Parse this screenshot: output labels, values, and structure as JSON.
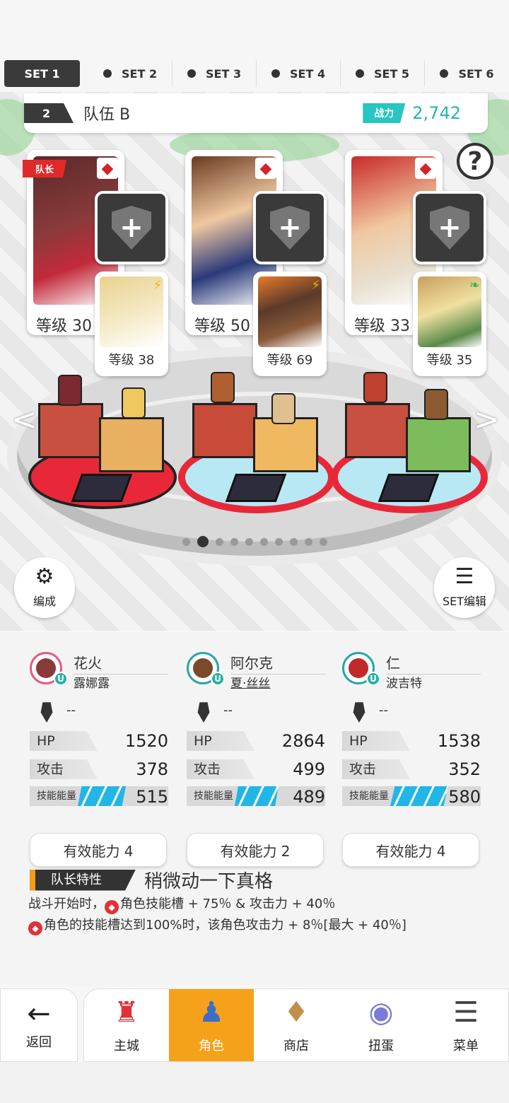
{
  "set_tabs": [
    {
      "label": "SET 1",
      "active": true
    },
    {
      "label": "SET 2",
      "active": false
    },
    {
      "label": "SET 3",
      "active": false
    },
    {
      "label": "SET 4",
      "active": false
    },
    {
      "label": "SET 5",
      "active": false
    },
    {
      "label": "SET 6",
      "active": false
    }
  ],
  "team": {
    "number": "2",
    "name": "队伍 B",
    "power_label": "战力",
    "power_value": "2,742"
  },
  "leader_tag": "队长",
  "characters": [
    {
      "level": "等级 30",
      "sub_level": "等级 38",
      "sub_element": "⚡",
      "sub_element_color": "#f0b400"
    },
    {
      "level": "等级 50",
      "sub_level": "等级 69",
      "sub_element": "⚡",
      "sub_element_color": "#f0b400"
    },
    {
      "level": "等级 33",
      "sub_level": "等级 35",
      "sub_element": "❧",
      "sub_element_color": "#3cb44a"
    }
  ],
  "help_label": "?",
  "buttons": {
    "formation": "编成",
    "set_edit": "SET编辑"
  },
  "page_dots": {
    "count": 10,
    "active": 1
  },
  "stats": [
    {
      "name": "花火",
      "sub": "露娜露",
      "weapon": "--",
      "hp_label": "HP",
      "hp": "1520",
      "atk_label": "攻击",
      "atk": "378",
      "skill_label": "技能能量",
      "skill": "515",
      "skill_fill": 0.55,
      "ability": "有效能力 4"
    },
    {
      "name": "阿尔克",
      "sub": "夏·丝丝",
      "weapon": "--",
      "hp_label": "HP",
      "hp": "2864",
      "atk_label": "攻击",
      "atk": "499",
      "skill_label": "技能能量",
      "skill": "489",
      "skill_fill": 0.52,
      "ability": "有效能力 2"
    },
    {
      "name": "仁",
      "sub": "波吉特",
      "weapon": "--",
      "hp_label": "HP",
      "hp": "1538",
      "atk_label": "攻击",
      "atk": "352",
      "skill_label": "技能能量",
      "skill": "580",
      "skill_fill": 0.62,
      "ability": "有效能力 4"
    }
  ],
  "leader_trait": {
    "label": "队长特性",
    "name": "稍微动一下真格",
    "line1": "战斗开始时，",
    "line1b": "角色技能槽 + 75％ & 攻击力 + 40％",
    "line2": "角色的技能槽达到100%时，该角色攻击力 + 8％[最大 + 40％]"
  },
  "nav": {
    "back": "返回",
    "tabs": [
      {
        "label": "主城",
        "active": false
      },
      {
        "label": "角色",
        "active": true
      },
      {
        "label": "商店",
        "active": false
      },
      {
        "label": "扭蛋",
        "active": false
      },
      {
        "label": "菜单",
        "active": false
      }
    ]
  },
  "colors": {
    "accent": "#f5a11a",
    "power": "#27c6c0",
    "skill_bar": "#22b6e6",
    "red": "#e0303a"
  }
}
